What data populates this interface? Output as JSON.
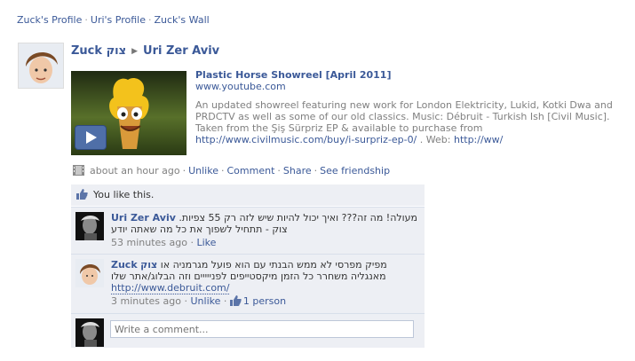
{
  "nav": {
    "items": [
      "Zuck's Profile",
      "Uri's Profile",
      "Zuck's Wall"
    ],
    "separator": "·"
  },
  "post": {
    "actor": "Zuck צוק",
    "target": "Uri Zer Aviv",
    "attachment": {
      "title": "Plastic Horse Showreel [April 2011]",
      "domain": "www.youtube.com",
      "description_text": "An updated showreel featuring new work for London Elektricity, Lukid, Kotki Dwa and PRDCTV as well as some of our old classics. Music: Débruit - Turkish Ish [Civil Music]. Taken from the Şiş Sürpriz EP & available to purchase from",
      "description_link": "http://www.civilmusic.com/buy/i-surpriz-ep-0/",
      "description_tail": ". Web:",
      "web_link": "http://ww/"
    },
    "meta": {
      "time": "about an hour ago",
      "unlike": "Unlike",
      "comment": "Comment",
      "share": "Share",
      "see_friendship": "See friendship"
    },
    "likes_text": "You like this.",
    "comments": [
      {
        "author": "Uri Zer Aviv",
        "text": "מעולה! מה זה??? ואיך יכול להיות שיש לזה רק 55 צפיות. צוק - תתחיל לשפוך את כל מה שאתה יודע",
        "time": "53 minutes ago",
        "action": "Like"
      },
      {
        "author": "Zuck",
        "author_extra": "צוק",
        "text": "מפיק מפרסי לא ממש הבנתי עם הוא פועל מגרמניה או מאנגליה משחרר כל הזמן מיקסטייפים לפנייייים וזה הבלוג/אתר שלו",
        "link": "http://www.debruit.com/",
        "time": "3 minutes ago",
        "action": "Unlike",
        "likes": "1 person"
      }
    ],
    "composer_placeholder": "Write a comment..."
  }
}
